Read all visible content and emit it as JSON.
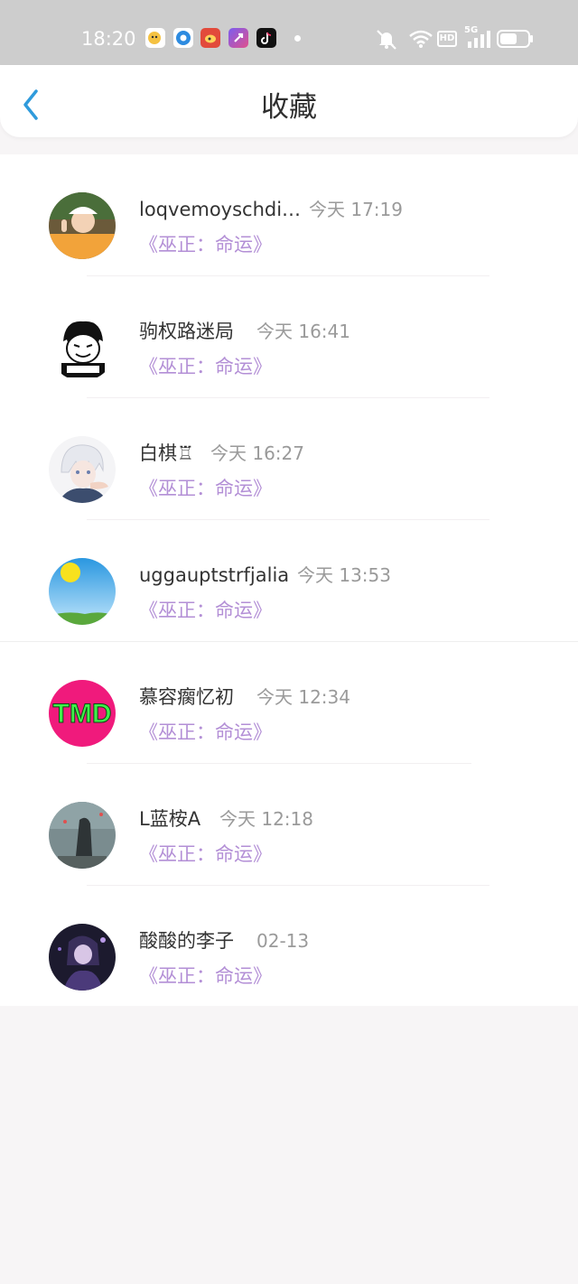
{
  "status_bar": {
    "time": "18:20",
    "network": "5G",
    "hd": "HD",
    "app_icons": [
      "wechat-icon",
      "qq-browser-icon",
      "weibo-icon",
      "shortcut-app-icon",
      "tiktok-icon"
    ],
    "status_icons": [
      "mute-icon",
      "wifi-icon",
      "hd-icon",
      "signal-icon",
      "battery-icon"
    ]
  },
  "header": {
    "title": "收藏",
    "back_icon": "chevron-left-icon"
  },
  "colors": {
    "accent_blue": "#2f9bdc",
    "book_purple": "#b38fd6",
    "name_text": "#333333",
    "time_text": "#9a9a9a"
  },
  "favorites": [
    {
      "name": "loqvemoyschdi…",
      "time": "今天 17:19",
      "book": "《巫正：命运》"
    },
    {
      "name": "驹权路迷局",
      "time": "今天 16:41",
      "book": "《巫正：命运》"
    },
    {
      "name": "白棋♖",
      "time": "今天 16:27",
      "book": "《巫正：命运》"
    },
    {
      "name": "uggauptstrfjalia",
      "time": "今天 13:53",
      "book": "《巫正：命运》"
    },
    {
      "name": "慕容瘸忆初",
      "time": "今天 12:34",
      "book": "《巫正：命运》"
    },
    {
      "name": "L蓝桉A",
      "time": "今天 12:18",
      "book": "《巫正：命运》"
    },
    {
      "name": "酸酸的李子",
      "time": "02-13",
      "book": "《巫正：命运》"
    }
  ],
  "avatars": {
    "tmd_text": "TMD"
  }
}
